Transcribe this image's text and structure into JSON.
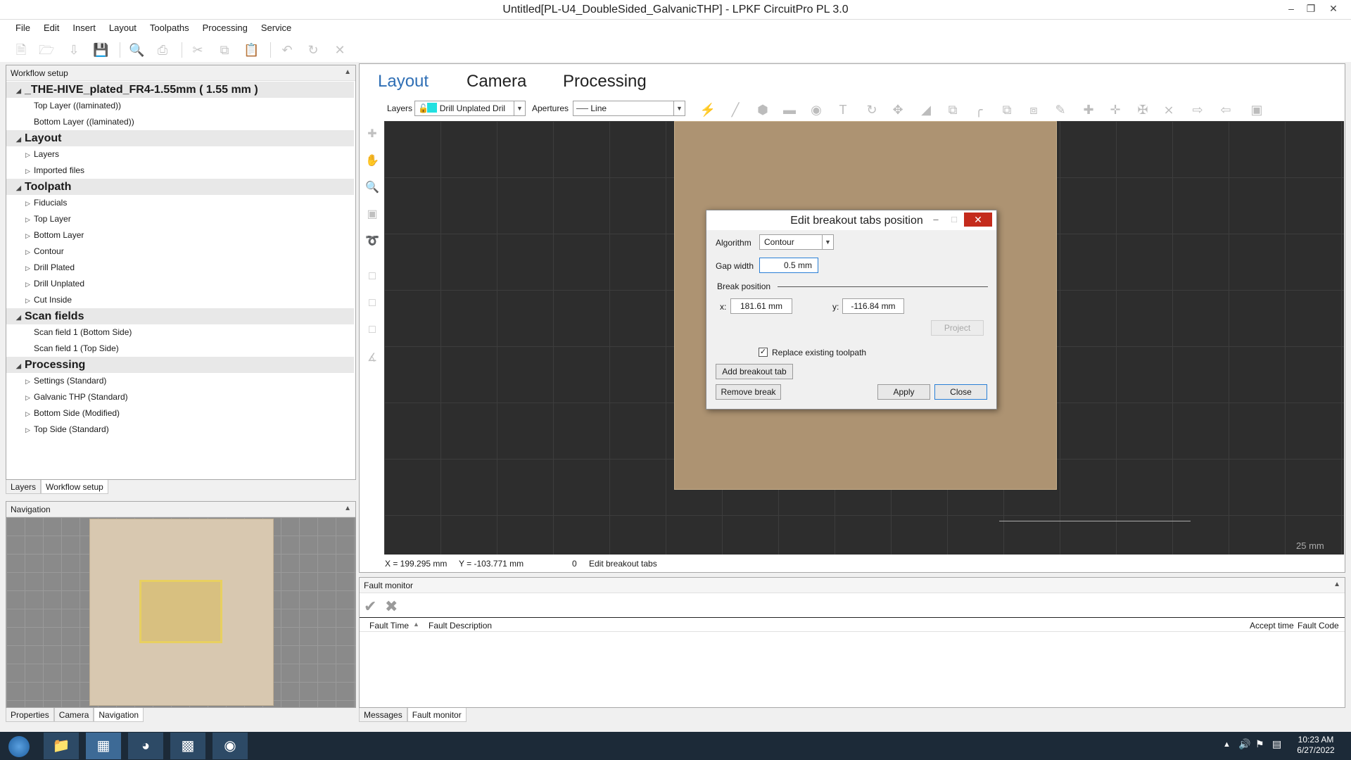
{
  "window": {
    "title": "Untitled[PL-U4_DoubleSided_GalvanicTHP] - LPKF CircuitPro PL 3.0"
  },
  "menu": [
    "File",
    "Edit",
    "Insert",
    "Layout",
    "Toolpaths",
    "Processing",
    "Service"
  ],
  "toolbar_icons": [
    "new-icon",
    "open-icon",
    "import-icon",
    "save-icon",
    "print-preview-icon",
    "print-icon",
    "cut-icon",
    "copy-icon",
    "paste-icon",
    "undo-icon",
    "redo-icon",
    "delete-icon"
  ],
  "workflow": {
    "header": "Workflow setup",
    "root": "_THE-HIVE_plated_FR4-1.55mm ( 1.55 mm )",
    "root_items": [
      "Top Layer ((laminated))",
      "Bottom Layer ((laminated))"
    ],
    "categories": [
      {
        "label": "Layout",
        "items": [
          "Layers",
          "Imported files"
        ]
      },
      {
        "label": "Toolpath",
        "items": [
          "Fiducials",
          "Top Layer",
          "Bottom Layer",
          "Contour",
          "Drill Plated",
          "Drill Unplated",
          "Cut Inside"
        ]
      },
      {
        "label": "Scan fields",
        "items": [
          "Scan field 1 (Bottom Side)",
          "Scan field 1 (Top Side)"
        ]
      },
      {
        "label": "Processing",
        "items": [
          "Settings (Standard)",
          "Galvanic THP (Standard)",
          "Bottom Side (Modified)",
          "Top Side (Standard)"
        ]
      }
    ],
    "tabs": [
      "Layers",
      "Workflow setup"
    ]
  },
  "navigation": {
    "header": "Navigation",
    "tabs": [
      "Properties",
      "Camera",
      "Navigation"
    ]
  },
  "main": {
    "tabs": [
      "Layout",
      "Camera",
      "Processing"
    ],
    "layers_label": "Layers",
    "layer_value": "Drill Unplated Dril",
    "layer_color": "#22e0e0",
    "apertures_label": "Apertures",
    "aperture_value": "Line",
    "scale_label": "25 mm"
  },
  "status": {
    "x": "X =    199.295 mm",
    "y": "Y =   -103.771 mm",
    "count": "0",
    "mode": "Edit breakout tabs"
  },
  "dialog": {
    "title": "Edit breakout tabs position",
    "algorithm_label": "Algorithm",
    "algorithm_value": "Contour",
    "gap_label": "Gap width",
    "gap_value": "0.5 mm",
    "break_label": "Break position",
    "x_label": "x:",
    "x_value": "181.61 mm",
    "y_label": "y:",
    "y_value": "-116.84 mm",
    "project_label": "Project",
    "replace_label": "Replace existing toolpath",
    "replace_checked": true,
    "add_label": "Add breakout tab",
    "remove_label": "Remove break",
    "apply_label": "Apply",
    "close_label": "Close"
  },
  "fault": {
    "header": "Fault monitor",
    "columns": [
      "Fault Time",
      "Fault Description",
      "Accept time",
      "Fault Code"
    ],
    "tabs": [
      "Messages",
      "Fault monitor"
    ]
  },
  "taskbar": {
    "time": "10:23 AM",
    "date": "6/27/2022"
  }
}
